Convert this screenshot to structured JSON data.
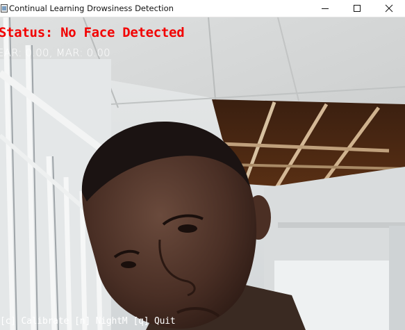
{
  "window": {
    "title": "Continual Learning Drowsiness Detection",
    "icon": "app-window-icon",
    "controls": [
      "minimize-icon",
      "maximize-icon",
      "close-icon"
    ]
  },
  "video": {
    "status": "Status: No Face Detected",
    "metrics": "EAR: 0.00, MAR: 0.00",
    "help": [
      "[c] Calibrate",
      "[n] NightM",
      "[q] Quit"
    ],
    "colors": {
      "status": "#f20000",
      "metrics": "#ffffff",
      "help": "#ffffff"
    }
  }
}
